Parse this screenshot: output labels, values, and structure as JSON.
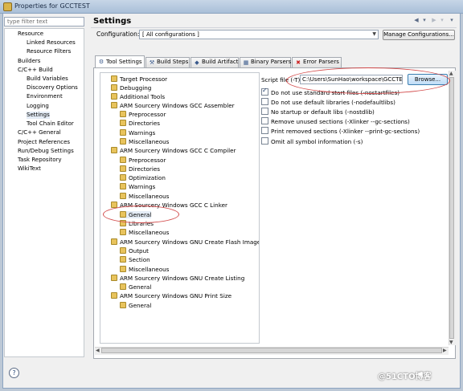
{
  "window": {
    "title": "Properties for GCCTEST"
  },
  "nav": {
    "filter_placeholder": "type filter text",
    "items": [
      {
        "label": "Resource"
      },
      {
        "label": "Linked Resources"
      },
      {
        "label": "Resource Filters"
      },
      {
        "label": "Builders"
      },
      {
        "label": "C/C++ Build"
      },
      {
        "label": "Build Variables"
      },
      {
        "label": "Discovery Options"
      },
      {
        "label": "Environment"
      },
      {
        "label": "Logging"
      },
      {
        "label": "Settings"
      },
      {
        "label": "Tool Chain Editor"
      },
      {
        "label": "C/C++ General"
      },
      {
        "label": "Project References"
      },
      {
        "label": "Run/Debug Settings"
      },
      {
        "label": "Task Repository"
      },
      {
        "label": "WikiText"
      }
    ]
  },
  "header": {
    "title": "Settings",
    "configuration_label": "Configuration:",
    "configuration_value": "[ All configurations ]",
    "manage_button": "Manage Configurations..."
  },
  "tabs": [
    {
      "label": "Tool Settings",
      "icon": "tool-settings-icon"
    },
    {
      "label": "Build Steps",
      "icon": "build-steps-icon"
    },
    {
      "label": "Build Artifact",
      "icon": "build-artifact-icon"
    },
    {
      "label": "Binary Parsers",
      "icon": "binary-parsers-icon"
    },
    {
      "label": "Error Parsers",
      "icon": "error-parsers-icon"
    }
  ],
  "tree": [
    {
      "label": "Target Processor"
    },
    {
      "label": "Debugging"
    },
    {
      "label": "Additional Tools"
    },
    {
      "label": "ARM Sourcery Windows GCC Assembler"
    },
    {
      "label": "Preprocessor"
    },
    {
      "label": "Directories"
    },
    {
      "label": "Warnings"
    },
    {
      "label": "Miscellaneous"
    },
    {
      "label": "ARM Sourcery Windows GCC C Compiler"
    },
    {
      "label": "Preprocessor"
    },
    {
      "label": "Directories"
    },
    {
      "label": "Optimization"
    },
    {
      "label": "Warnings"
    },
    {
      "label": "Miscellaneous"
    },
    {
      "label": "ARM Sourcery Windows GCC C Linker"
    },
    {
      "label": "General"
    },
    {
      "label": "Libraries"
    },
    {
      "label": "Miscellaneous"
    },
    {
      "label": "ARM Sourcery Windows GNU Create Flash Image"
    },
    {
      "label": "Output"
    },
    {
      "label": "Section"
    },
    {
      "label": "Miscellaneous"
    },
    {
      "label": "ARM Sourcery Windows GNU Create Listing"
    },
    {
      "label": "General"
    },
    {
      "label": "ARM Sourcery Windows GNU Print Size"
    },
    {
      "label": "General"
    }
  ],
  "linker_general": {
    "script_label": "Script file (-T)",
    "script_value": "C:\\Users\\SunHao\\workspace\\GCCTES",
    "browse_button": "Browse...",
    "options": [
      {
        "label": "Do not use standard start files (-nostartfiles)",
        "checked": true
      },
      {
        "label": "Do not use default libraries (-nodefaultlibs)",
        "checked": false
      },
      {
        "label": "No startup or default libs (-nostdlib)",
        "checked": false
      },
      {
        "label": "Remove unused sections (-Xlinker --gc-sections)",
        "checked": false
      },
      {
        "label": "Print removed sections (-Xlinker --print-gc-sections)",
        "checked": false
      },
      {
        "label": "Omit all symbol information (-s)",
        "checked": false
      }
    ]
  },
  "watermark": "@51CTO博客",
  "colors": {
    "annotation": "#d24a4a",
    "selection": "#e4ecf6"
  }
}
